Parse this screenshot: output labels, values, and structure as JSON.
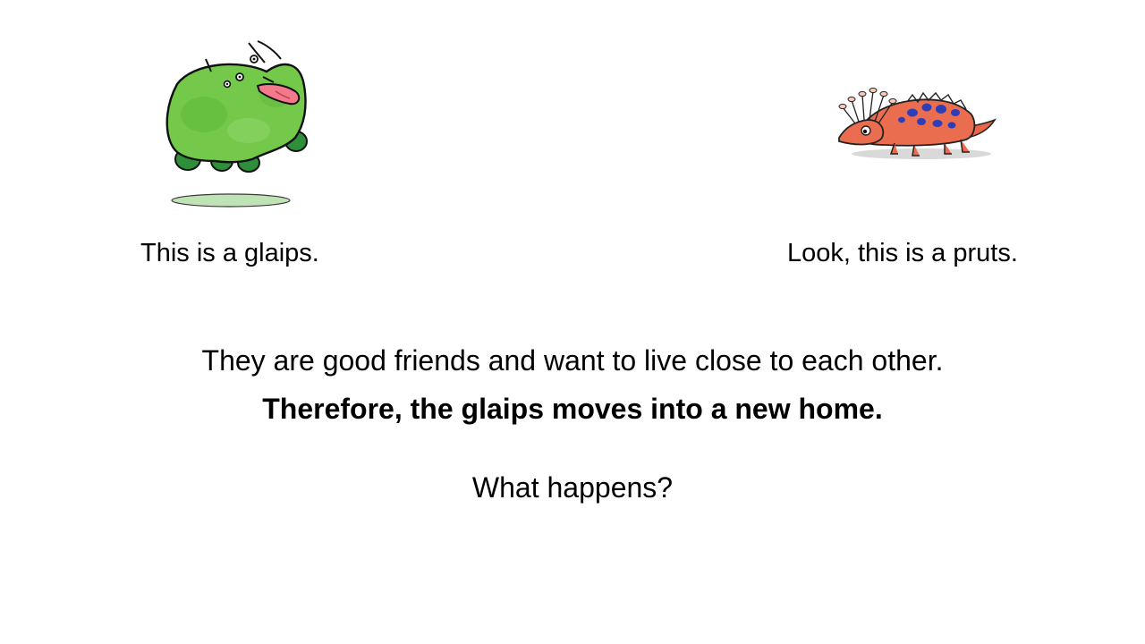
{
  "characters": {
    "glaips": {
      "caption": "This is a glaips.",
      "icon": "green-blob-creature-icon",
      "color": "#6cc640"
    },
    "pruts": {
      "caption": "Look, this is a pruts.",
      "icon": "orange-spiky-creature-icon",
      "color": "#e8674a"
    }
  },
  "story": {
    "friends_line": "They are good friends and want to live close to each other.",
    "therefore_line": "Therefore, the glaips moves into a new home.",
    "question": "What happens?"
  }
}
